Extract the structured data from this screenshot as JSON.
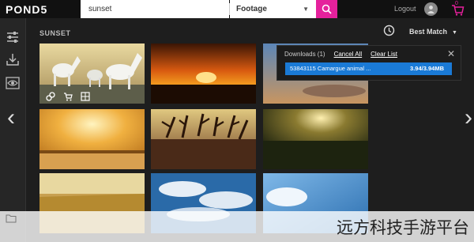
{
  "header": {
    "logo": "POND5",
    "search_value": "sunset",
    "media_type": "Footage",
    "logout_label": "Logout",
    "cart_count": "0"
  },
  "results": {
    "title": "SUNSET",
    "sort_label": "Best Match"
  },
  "downloads": {
    "title": "Downloads (1)",
    "cancel_all": "Cancel All",
    "clear_list": "Clear List",
    "items": [
      {
        "label": "53843115 Camargue animal ...",
        "size": "3.94/3.94MB"
      }
    ]
  },
  "watermark": "远方科技手游平台",
  "icons": {
    "sidebar": [
      "sliders-icon",
      "download-tray-icon",
      "eye-icon"
    ],
    "thumb_actions": [
      "link-icon",
      "cart-icon",
      "grid-icon"
    ]
  },
  "colors": {
    "accent": "#e5219c",
    "download_highlight": "#1a7ad6",
    "background": "#1e1e1e"
  }
}
